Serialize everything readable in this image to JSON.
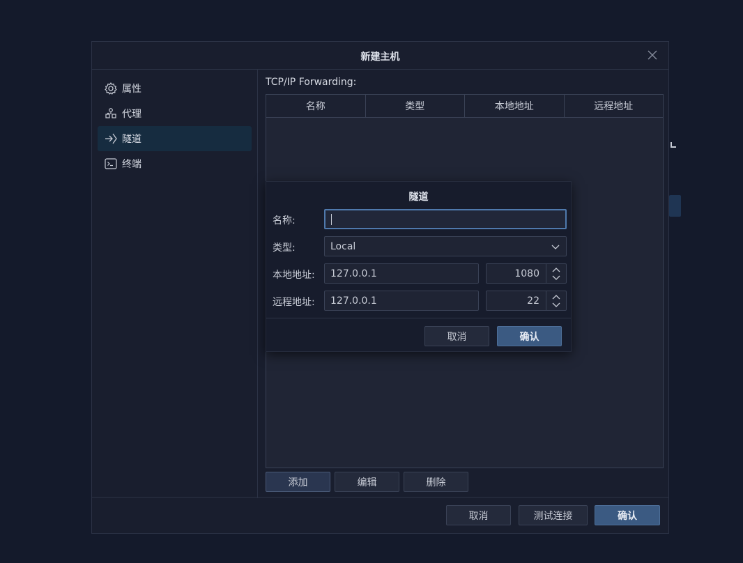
{
  "dialog": {
    "title": "新建主机",
    "sidebar": [
      {
        "label": "属性",
        "icon": "gear-icon"
      },
      {
        "label": "代理",
        "icon": "network-icon"
      },
      {
        "label": "隧道",
        "icon": "tunnel-arrow-icon",
        "active": true
      },
      {
        "label": "终端",
        "icon": "terminal-icon"
      }
    ],
    "tcp_label": "TCP/IP Forwarding:",
    "table_headers": [
      "名称",
      "类型",
      "本地地址",
      "远程地址"
    ],
    "table_rows": [],
    "table_buttons": {
      "add": "添加",
      "edit": "编辑",
      "delete": "删除"
    },
    "footer": {
      "cancel": "取消",
      "test": "测试连接",
      "confirm": "确认"
    }
  },
  "tunnel": {
    "title": "隧道",
    "name_label": "名称:",
    "name_value": "",
    "type_label": "类型:",
    "type_value": "Local",
    "local_label": "本地地址:",
    "local_host": "127.0.0.1",
    "local_port": "1080",
    "remote_label": "远程地址:",
    "remote_host": "127.0.0.1",
    "remote_port": "22",
    "cancel": "取消",
    "confirm": "确认"
  },
  "colors": {
    "background": "#141a2b",
    "panel": "#191e2e",
    "active_item": "#162c40",
    "primary_button": "#3b5a82",
    "focus_border": "#4f79ad"
  }
}
